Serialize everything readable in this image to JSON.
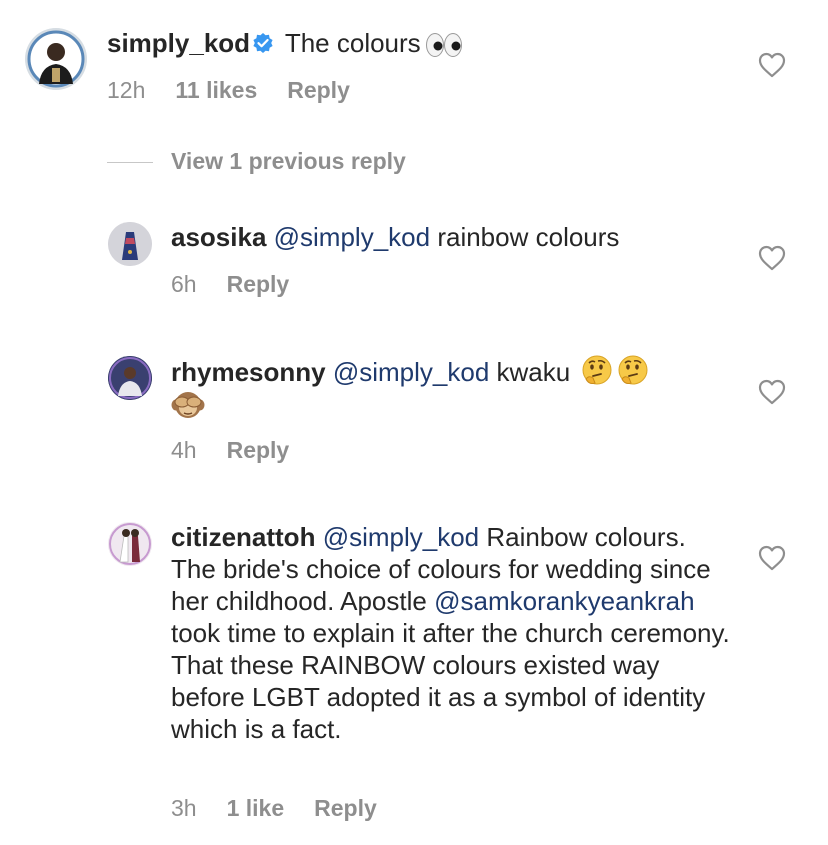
{
  "comments": [
    {
      "username": "simply_kod",
      "verified": true,
      "text": "The colours",
      "emoji": "eyes",
      "time": "12h",
      "likes": "11 likes",
      "reply": "Reply"
    }
  ],
  "view_replies": "View 1 previous reply",
  "replies": [
    {
      "username": "asosika",
      "mention": "@simply_kod",
      "text": "rainbow colours",
      "time": "6h",
      "reply": "Reply"
    },
    {
      "username": "rhymesonny",
      "mention": "@simply_kod",
      "text": "kwaku",
      "emojis": [
        "thinking-face",
        "thinking-face",
        "see-no-evil-monkey"
      ],
      "time": "4h",
      "reply": "Reply"
    },
    {
      "username": "citizenattoh",
      "mention": "@simply_kod",
      "text_part1": "Rainbow colours. The bride's choice of colours for wedding since her childhood. Apostle",
      "mention2": "@samkorankyeankrah",
      "text_part2": "took time to explain it after the church ceremony. That these RAINBOW colours existed way before LGBT adopted it as a symbol of identity which is a fact.",
      "time": "3h",
      "likes": "1 like",
      "reply": "Reply"
    }
  ],
  "colors": {
    "text": "#262626",
    "meta": "#8e8e8e",
    "mention": "#1f3a6d",
    "verified": "#3897f0"
  }
}
